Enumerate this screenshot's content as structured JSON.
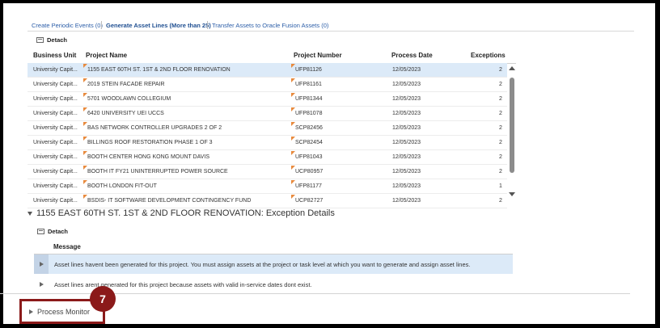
{
  "tabs": [
    {
      "label": "Create Periodic Events (0)"
    },
    {
      "label": "Generate Asset Lines (More than 25)"
    },
    {
      "label": "Transfer Assets to Oracle Fusion Assets (0)"
    }
  ],
  "detach_label": "Detach",
  "columns": {
    "business_unit": "Business Unit",
    "project_name": "Project Name",
    "project_number": "Project Number",
    "process_date": "Process Date",
    "exceptions": "Exceptions"
  },
  "rows": [
    {
      "bu": "University Capit...",
      "name": "1155 EAST 60TH ST. 1ST & 2ND FLOOR RENOVATION",
      "number": "UFP81126",
      "date": "12/05/2023",
      "exceptions": "2"
    },
    {
      "bu": "University Capit...",
      "name": "2019 STEIN FACADE REPAIR",
      "number": "UFP81161",
      "date": "12/05/2023",
      "exceptions": "2"
    },
    {
      "bu": "University Capit...",
      "name": "5701 WOODLAWN COLLEGIUM",
      "number": "UFP81344",
      "date": "12/05/2023",
      "exceptions": "2"
    },
    {
      "bu": "University Capit...",
      "name": "6420 UNIVERSITY UEI UCCS",
      "number": "UFP81078",
      "date": "12/05/2023",
      "exceptions": "2"
    },
    {
      "bu": "University Capit...",
      "name": "BAS NETWORK CONTROLLER UPGRADES 2 OF 2",
      "number": "SCP82456",
      "date": "12/05/2023",
      "exceptions": "2"
    },
    {
      "bu": "University Capit...",
      "name": "BILLINGS ROOF RESTORATION PHASE 1 OF 3",
      "number": "SCP82454",
      "date": "12/05/2023",
      "exceptions": "2"
    },
    {
      "bu": "University Capit...",
      "name": "BOOTH CENTER HONG KONG MOUNT DAVIS",
      "number": "UFP81043",
      "date": "12/05/2023",
      "exceptions": "2"
    },
    {
      "bu": "University Capit...",
      "name": "BOOTH IT FY21 UNINTERRUPTED POWER SOURCE",
      "number": "UCP80957",
      "date": "12/05/2023",
      "exceptions": "2"
    },
    {
      "bu": "University Capit...",
      "name": "BOOTH LONDON FIT-OUT",
      "number": "UFP81177",
      "date": "12/05/2023",
      "exceptions": "1"
    },
    {
      "bu": "University Capit...",
      "name": "BSDIS- IT SOFTWARE DEVELOPMENT CONTINGENCY FUND",
      "number": "UCP82727",
      "date": "12/05/2023",
      "exceptions": "2"
    }
  ],
  "exception_section": {
    "title": "1155 EAST 60TH ST. 1ST & 2ND FLOOR RENOVATION: Exception Details",
    "message_header": "Message",
    "messages": [
      "Asset lines havent been generated for this project. You must assign assets at the project or task level at which you want to generate and assign asset lines.",
      "Asset lines arent generated for this project because assets with valid in-service dates dont exist."
    ]
  },
  "process_monitor": "Process Monitor",
  "callout_number": "7",
  "colors": {
    "accent": "#2c5ea8",
    "selected_row": "#dceaf8",
    "callout": "#8b1a1a",
    "flag": "#e88a3d"
  }
}
